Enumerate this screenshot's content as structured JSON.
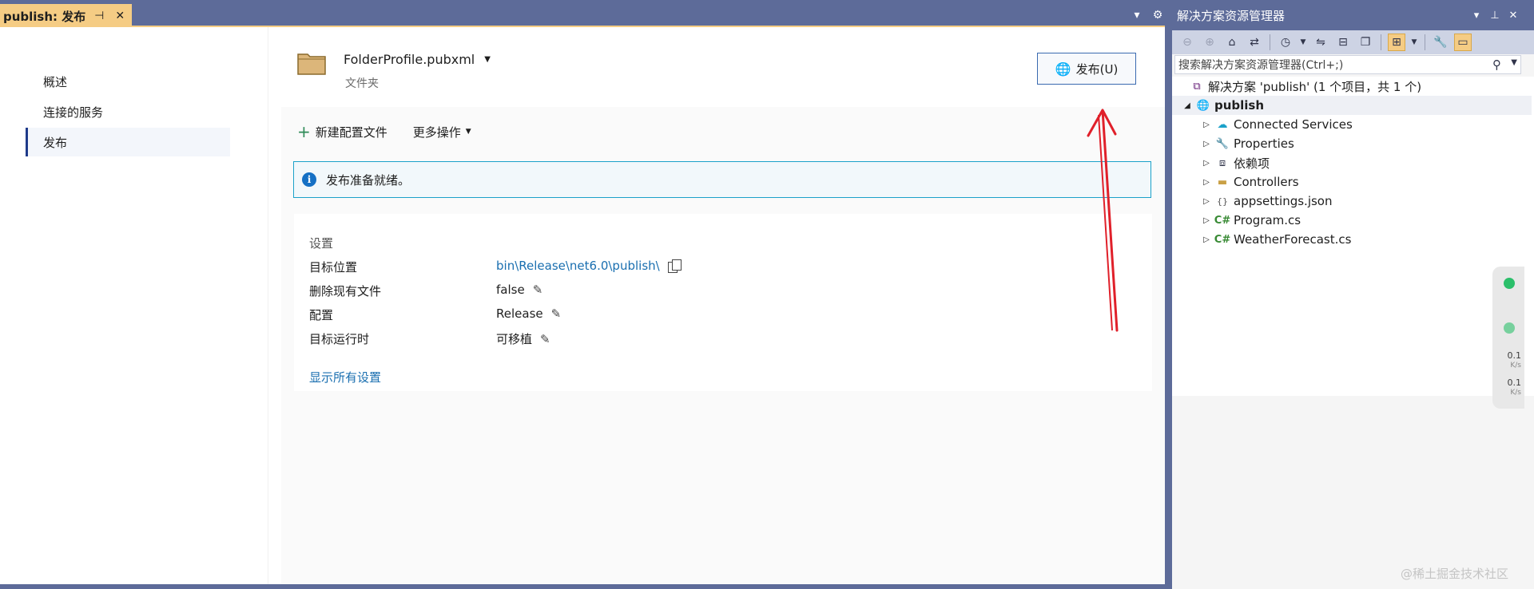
{
  "document_tab": {
    "title": "publish: 发布",
    "pin_icon": "pin-icon",
    "close_icon": "close-icon"
  },
  "left_nav": {
    "items": [
      {
        "label": "概述",
        "active": false
      },
      {
        "label": "连接的服务",
        "active": false
      },
      {
        "label": "发布",
        "active": true
      }
    ]
  },
  "profile": {
    "name": "FolderProfile.pubxml",
    "subtitle": "文件夹",
    "publish_button": "发布(U)"
  },
  "actions": {
    "new_profile": "新建配置文件",
    "more_actions": "更多操作"
  },
  "info_bar": {
    "message": "发布准备就绪。"
  },
  "settings": {
    "title": "设置",
    "rows": [
      {
        "label": "目标位置",
        "value": "bin\\Release\\net6.0\\publish\\"
      },
      {
        "label": "删除现有文件",
        "value": "false"
      },
      {
        "label": "配置",
        "value": "Release"
      },
      {
        "label": "目标运行时",
        "value": "可移植"
      }
    ],
    "show_all": "显示所有设置"
  },
  "solution_explorer": {
    "title": "解决方案资源管理器",
    "search_placeholder": "搜索解决方案资源管理器(Ctrl+;)",
    "solution_label": "解决方案 'publish' (1 个项目，共 1 个)",
    "project": "publish",
    "items": [
      {
        "label": "Connected Services",
        "icon": "cloud-icon"
      },
      {
        "label": "Properties",
        "icon": "wrench-icon"
      },
      {
        "label": "依赖项",
        "icon": "dependencies-icon"
      },
      {
        "label": "Controllers",
        "icon": "folder-icon"
      },
      {
        "label": "appsettings.json",
        "icon": "json-file-icon"
      },
      {
        "label": "Program.cs",
        "icon": "csharp-file-icon"
      },
      {
        "label": "WeatherForecast.cs",
        "icon": "csharp-file-icon"
      }
    ]
  },
  "net_widget": {
    "up_value": "0.1",
    "up_unit": "K/s",
    "down_value": "0.1",
    "down_unit": "K/s"
  },
  "watermark": "@稀土掘金技术社区",
  "colors": {
    "chrome": "#5d6b99",
    "active_tab": "#f5cc84",
    "link": "#1a6fb0",
    "info_border": "#1ba1c9",
    "annotation_arrow": "#e0202a"
  }
}
